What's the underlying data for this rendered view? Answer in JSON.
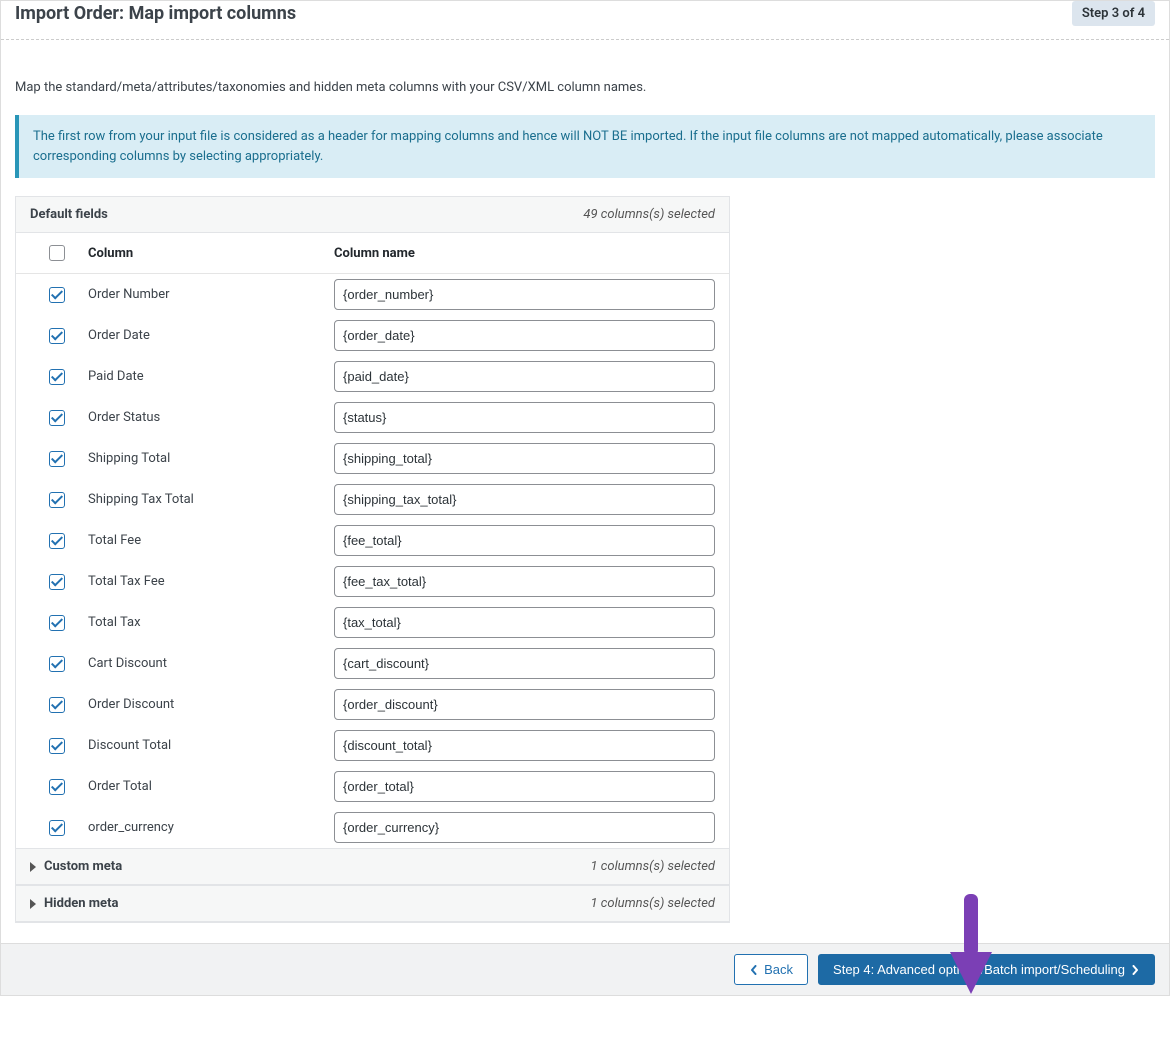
{
  "header": {
    "title": "Import Order: Map import columns",
    "step_badge": "Step 3 of 4"
  },
  "description": "Map the standard/meta/attributes/taxonomies and hidden meta columns with your CSV/XML column names.",
  "info_box": "The first row from your input file is considered as a header for mapping columns and hence will NOT BE imported. If the input file columns are not mapped automatically, please associate corresponding columns by selecting appropriately.",
  "default_fields": {
    "title": "Default fields",
    "count_label": "49 columns(s) selected",
    "header_col1": "Column",
    "header_col2": "Column name",
    "rows": [
      {
        "label": "Order Number",
        "value": "{order_number}"
      },
      {
        "label": "Order Date",
        "value": "{order_date}"
      },
      {
        "label": "Paid Date",
        "value": "{paid_date}"
      },
      {
        "label": "Order Status",
        "value": "{status}"
      },
      {
        "label": "Shipping Total",
        "value": "{shipping_total}"
      },
      {
        "label": "Shipping Tax Total",
        "value": "{shipping_tax_total}"
      },
      {
        "label": "Total Fee",
        "value": "{fee_total}"
      },
      {
        "label": "Total Tax Fee",
        "value": "{fee_tax_total}"
      },
      {
        "label": "Total Tax",
        "value": "{tax_total}"
      },
      {
        "label": "Cart Discount",
        "value": "{cart_discount}"
      },
      {
        "label": "Order Discount",
        "value": "{order_discount}"
      },
      {
        "label": "Discount Total",
        "value": "{discount_total}"
      },
      {
        "label": "Order Total",
        "value": "{order_total}"
      },
      {
        "label": "order_currency",
        "value": "{order_currency}"
      }
    ]
  },
  "custom_meta": {
    "title": "Custom meta",
    "count_label": "1 columns(s) selected"
  },
  "hidden_meta": {
    "title": "Hidden meta",
    "count_label": "1 columns(s) selected"
  },
  "footer": {
    "back_label": "Back",
    "next_label": "Step 4: Advanced options/Batch import/Scheduling"
  }
}
